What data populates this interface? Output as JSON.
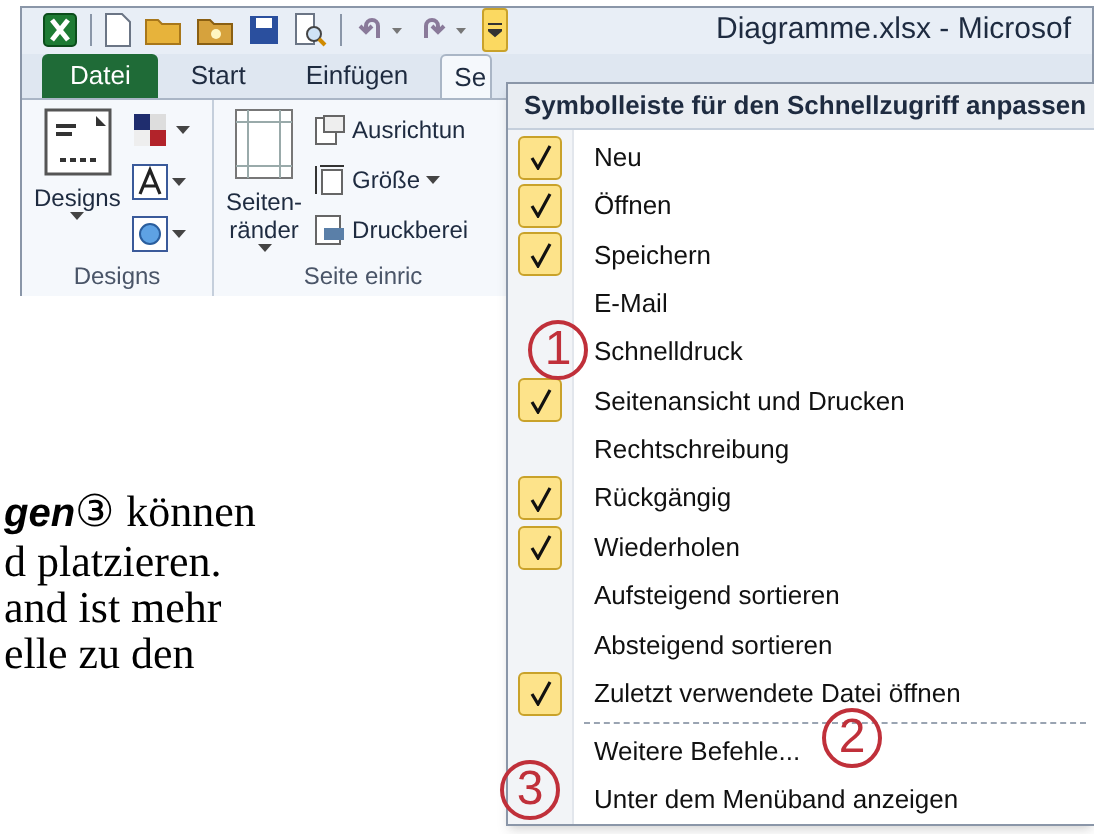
{
  "window": {
    "title": "Diagramme.xlsx - Microsof"
  },
  "quick_access_toolbar": {
    "customize_open": true
  },
  "tabs": [
    {
      "label": "Datei",
      "kind": "file",
      "selected": false
    },
    {
      "label": "Start",
      "kind": "tab",
      "selected": false
    },
    {
      "label": "Einfügen",
      "kind": "tab",
      "selected": false
    },
    {
      "label": "Se",
      "kind": "tab",
      "selected": true
    }
  ],
  "ribbon_groups": [
    {
      "label": "Designs",
      "big_button": [
        "Designs"
      ]
    },
    {
      "label": "Seite einric",
      "big_button": [
        "Seiten-",
        "ränder"
      ],
      "small_buttons": [
        {
          "label": "Ausrichtun",
          "caret": false
        },
        {
          "label": "Größe",
          "caret": true
        },
        {
          "label": "Druckberei",
          "caret": false
        }
      ]
    }
  ],
  "menu": {
    "title": "Symbolleiste für den Schnellzugriff anpassen",
    "items": [
      {
        "label": "Neu",
        "checked": true
      },
      {
        "label": "Öffnen",
        "checked": true
      },
      {
        "label": "Speichern",
        "checked": true
      },
      {
        "label": "E-Mail",
        "checked": false
      },
      {
        "label": "Schnelldruck",
        "checked": false
      },
      {
        "label": "Seitenansicht und Drucken",
        "checked": true
      },
      {
        "label": "Rechtschreibung",
        "checked": false
      },
      {
        "label": "Rückgängig",
        "checked": true
      },
      {
        "label": "Wiederholen",
        "checked": true
      },
      {
        "label": "Aufsteigend sortieren",
        "checked": false
      },
      {
        "label": "Absteigend sortieren",
        "checked": false
      },
      {
        "label": "Zuletzt verwendete Datei öffnen",
        "checked": true
      }
    ],
    "commands": [
      {
        "label": "Weitere Befehle..."
      },
      {
        "label": "Unter dem Menüband anzeigen"
      }
    ]
  },
  "markers": [
    {
      "label": "1"
    },
    {
      "label": "2"
    },
    {
      "label": "3"
    }
  ],
  "document_lines": [
    "**gen**③ können",
    "d platzieren.",
    "and ist mehr",
    "elle zu den"
  ]
}
